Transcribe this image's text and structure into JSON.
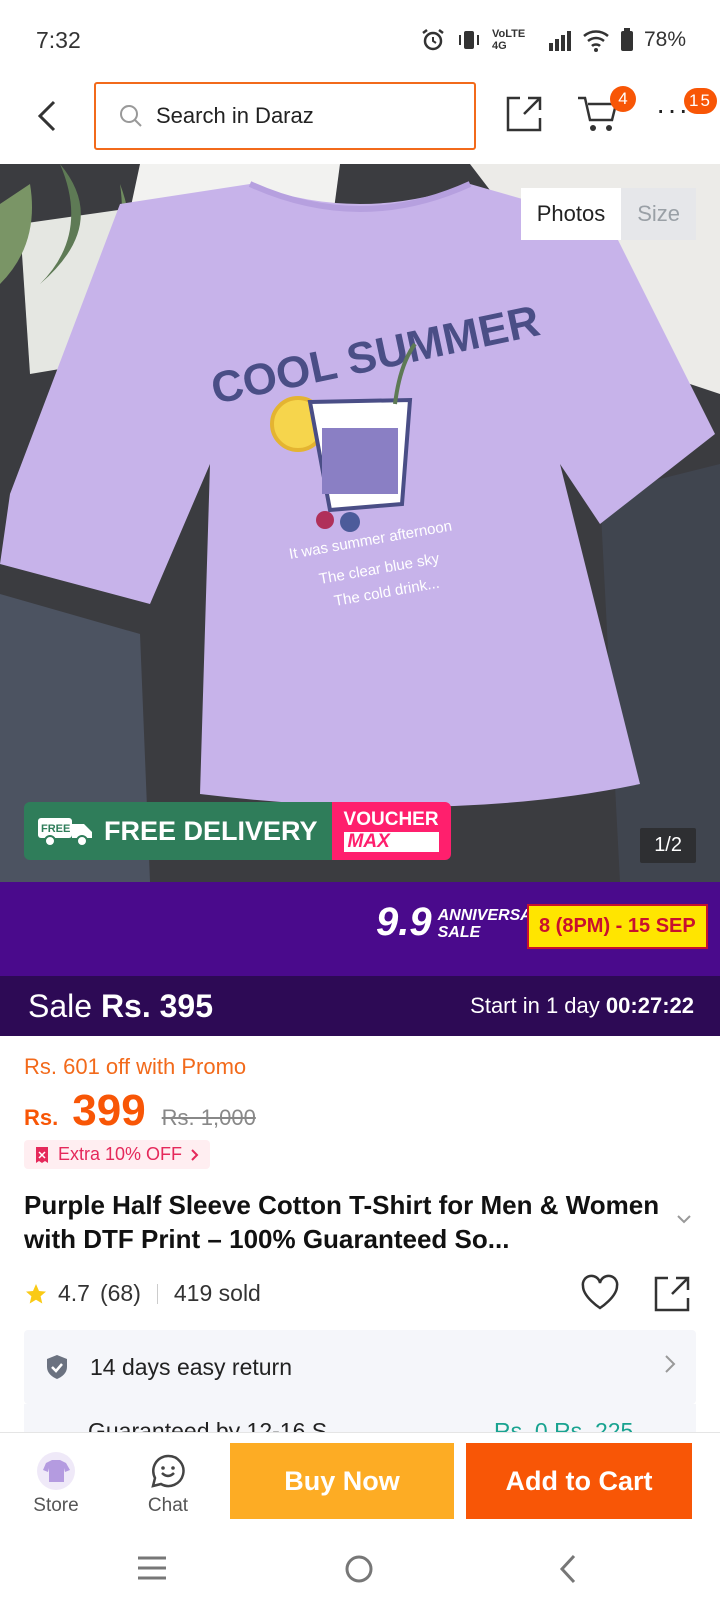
{
  "status": {
    "time": "7:32",
    "net_label": "VoLTE 4G",
    "battery": "78%"
  },
  "header": {
    "search_placeholder": "Search in Daraz",
    "cart_count": "4",
    "more_count": "15"
  },
  "gallery": {
    "tabs": [
      "Photos",
      "Size"
    ],
    "counter": "1/2",
    "free_badge": "FREE",
    "free_delivery": "FREE DELIVERY",
    "voucher_top": "VOUCHER",
    "voucher_bottom": "MAX",
    "print_title": "COOL SUMMER",
    "print_lines": [
      "It was summer afternoon",
      "The clear blue sky",
      "The cold drink..."
    ]
  },
  "campaign": {
    "logo_number": "9.9",
    "logo_text_1": "ANNIVERSARY",
    "logo_text_2": "SALE",
    "dates": "8 (8PM) - 15 SEP",
    "sale_label": "Sale",
    "sale_price": "Rs. 395",
    "start_label": "Start in 1 day",
    "countdown": "00:27:22"
  },
  "pricing": {
    "promo": "Rs. 601 off with Promo",
    "currency": "Rs.",
    "price": "399",
    "original": "Rs. 1,000",
    "extra": "Extra 10% OFF"
  },
  "product": {
    "title": "Purple Half Sleeve Cotton T-Shirt for Men & Women with DTF Print – 100% Guaranteed So...",
    "rating": "4.7",
    "reviews": "(68)",
    "sold": "419 sold"
  },
  "service": {
    "returns": "14 days easy return",
    "guarantee_peek": "Guaranteed by 12-16 S",
    "peek_price": "Rs. 0 Rs. 225"
  },
  "actions": {
    "store": "Store",
    "chat": "Chat",
    "buy_now": "Buy Now",
    "add_to_cart": "Add to Cart"
  },
  "colors": {
    "accent": "#f85606",
    "buy": "#fdac24",
    "campaign": "#4a0a8c",
    "shirt": "#c7b3ea"
  }
}
